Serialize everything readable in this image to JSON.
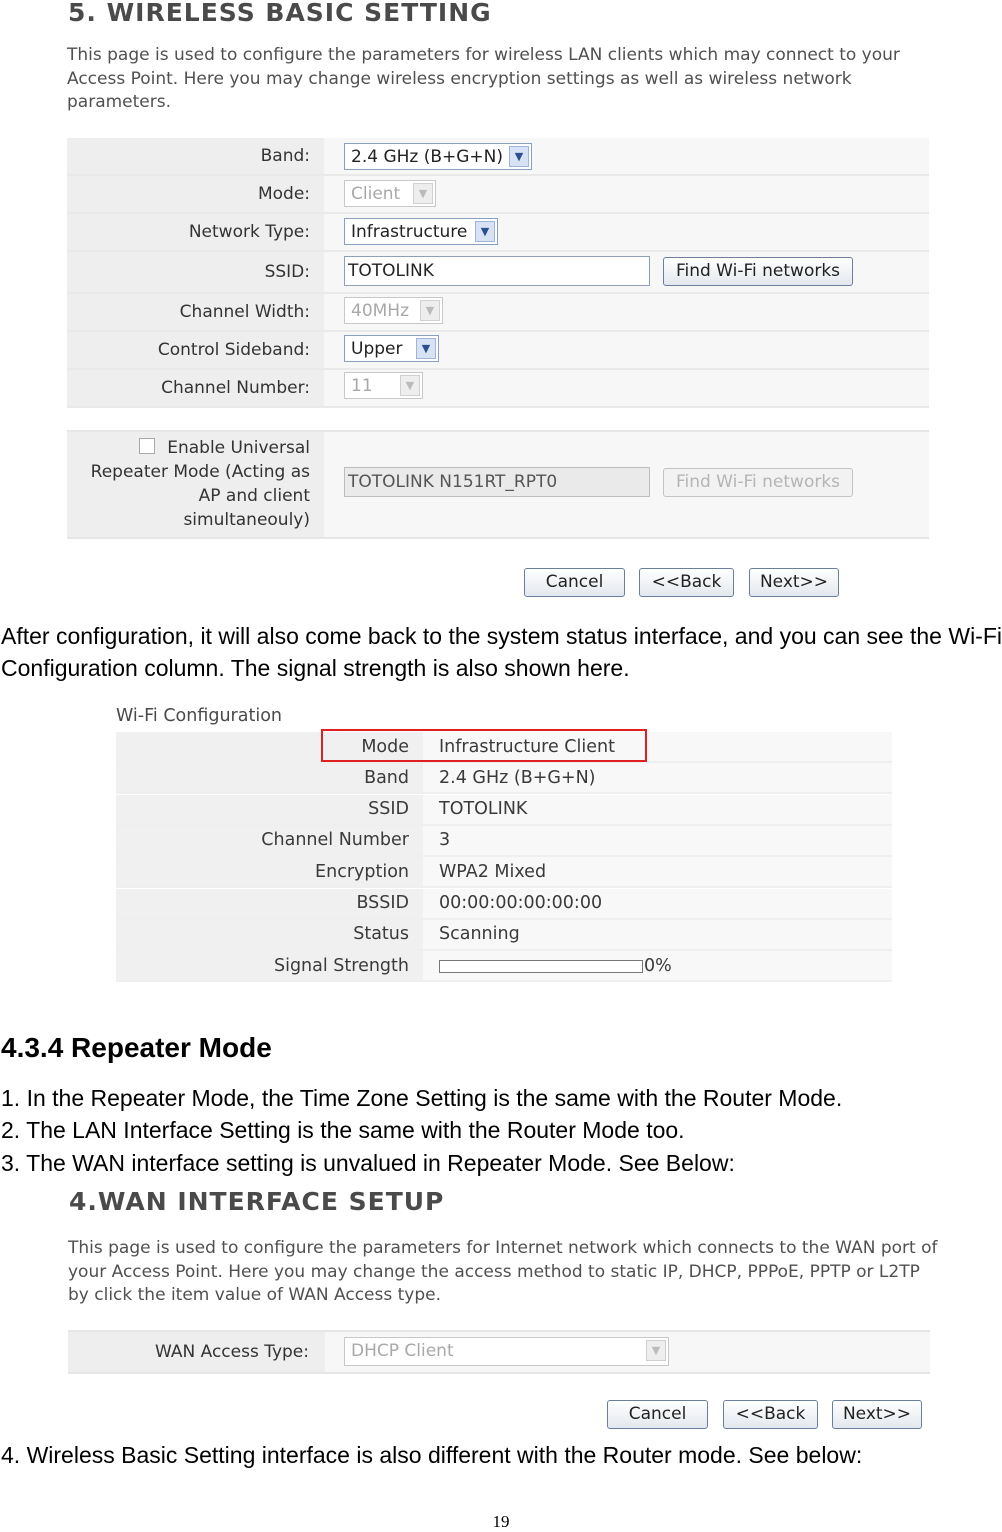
{
  "wireless_basic": {
    "title": "5. WIRELESS BASIC SETTING",
    "description": "This page is used to configure the parameters for wireless LAN clients which may connect to your Access Point. Here you may change wireless encryption settings as well as wireless network parameters.",
    "band_label": "Band:",
    "band_value": "2.4 GHz (B+G+N)",
    "mode_label": "Mode:",
    "mode_value": "Client",
    "network_type_label": "Network Type:",
    "network_type_value": "Infrastructure",
    "ssid_label": "SSID:",
    "ssid_value": "TOTOLINK",
    "find_wifi_label": "Find Wi-Fi networks",
    "channel_width_label": "Channel Width:",
    "channel_width_value": "40MHz",
    "control_sideband_label": "Control Sideband:",
    "control_sideband_value": "Upper",
    "channel_number_label": "Channel Number:",
    "channel_number_value": "11",
    "repeater_label": "Enable Universal Repeater Mode (Acting as AP and client simultaneouly)",
    "repeater_ssid": "TOTOLINK N151RT_RPT0",
    "repeater_find_label": "Find Wi-Fi networks",
    "cancel": "Cancel",
    "back": "<<Back",
    "next": "Next>>"
  },
  "para1": "After configuration, it will also come back to the system status interface, and you can see the Wi-Fi Configuration column. The signal strength is also shown here.",
  "wifi_config": {
    "title": "Wi-Fi Configuration",
    "rows": [
      {
        "label": "Mode",
        "value": "Infrastructure Client"
      },
      {
        "label": "Band",
        "value": "2.4 GHz (B+G+N)"
      },
      {
        "label": "SSID",
        "value": "TOTOLINK"
      },
      {
        "label": "Channel Number",
        "value": "3"
      },
      {
        "label": "Encryption",
        "value": "WPA2 Mixed"
      },
      {
        "label": "BSSID",
        "value": "00:00:00:00:00:00"
      },
      {
        "label": "Status",
        "value": "Scanning"
      },
      {
        "label": "Signal Strength",
        "value": "0%"
      }
    ],
    "signal_strength_fraction": 0,
    "highlight_color": "#e02020"
  },
  "section_heading": "4.3.4 Repeater Mode",
  "list": [
    "1. In the Repeater Mode, the Time Zone Setting is the same with the Router Mode.",
    "2. The LAN Interface Setting is the same with the Router Mode too.",
    "3. The WAN interface setting is unvalued in Repeater Mode. See Below:"
  ],
  "wan": {
    "title": "4.WAN INTERFACE SETUP",
    "description": "This page is used to configure the parameters for Internet network which connects to the WAN port of your Access Point. Here you may change the access method to static IP, DHCP, PPPoE, PPTP or L2TP by click the item value of WAN Access type.",
    "access_type_label": "WAN Access Type:",
    "access_type_value": "DHCP Client",
    "cancel": "Cancel",
    "back": "<<Back",
    "next": "Next>>"
  },
  "para4": "4. Wireless Basic Setting interface is also different with the Router mode. See below:",
  "page_number": "19"
}
